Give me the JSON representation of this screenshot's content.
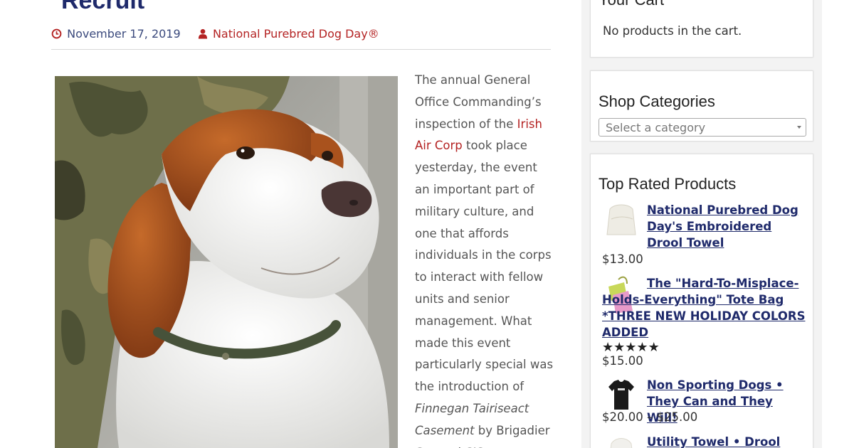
{
  "post": {
    "title": "Recruit",
    "date": "November 17, 2019",
    "category": "National Purebred Dog Day®",
    "photo_alt": "Irish Red and White Setter",
    "body": {
      "p1": "The annual General Office Commanding’s inspection of the",
      "link": "Irish Air Corp",
      "p2": "took place yesterday, the event an important part of military culture, and one that affords individuals in the corps to interact with fellow units and senior management. What made this event particularly special was the introduction of",
      "italic": "Finnegan Tairiseact Casement",
      "p3": "by Brigadier General CJS..."
    }
  },
  "sidebar": {
    "cart": {
      "title": "Your Cart",
      "empty": "No products in the cart."
    },
    "shop": {
      "title": "Shop Categories",
      "select_placeholder": "Select a category"
    },
    "top_rated": {
      "title": "Top Rated Products",
      "items": [
        {
          "name": "National Purebred Dog Day's Embroidered Drool Towel",
          "price": "$13.00",
          "thumb_icon": "towel-icon"
        },
        {
          "name": "The \"Hard-To-Misplace-Holds-Everything\" Tote Bag *THREE NEW HOLIDAY COLORS ADDED",
          "price": "$15.00",
          "rating": 5,
          "thumb_icon": "tote-bag-icon"
        },
        {
          "name": "Non Sporting Dogs • They Can and They Will!",
          "price": "$20.00 – $25.00",
          "thumb_icon": "tshirt-icon"
        },
        {
          "name": "Utility Towel • Drool Rag •",
          "price": "",
          "thumb_icon": "towel-icon"
        }
      ]
    }
  },
  "colors": {
    "title": "#1f2a6b",
    "accent": "#b42323",
    "meta_date": "#3b4a7d",
    "text": "#555555"
  },
  "icons": {
    "date": "clock-icon",
    "category": "user-icon",
    "select_arrow": "chevron-down-icon",
    "star": "star-icon"
  }
}
